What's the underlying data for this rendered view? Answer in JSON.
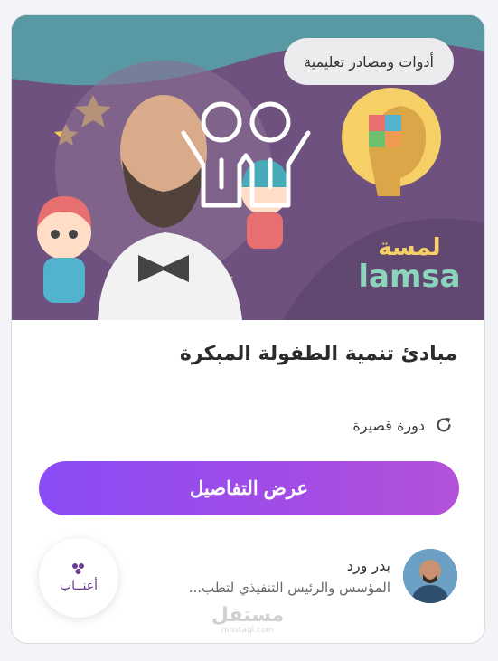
{
  "card": {
    "category_tag": "أدوات ومصادر تعليمية",
    "title": "مبادئ تنمية الطفولة المبكرة",
    "course_type": "دورة قصيرة",
    "cta_label": "عرض التفاصيل",
    "author": {
      "name": "بدر ورد",
      "role": "المؤسس والرئيس التنفيذي لتطب..."
    },
    "org_logo_text": "أعنــاب",
    "hero_logo_text": "lamsa",
    "hero_logo_arabic": "لمسة"
  },
  "watermark": {
    "main": "مستقل",
    "sub": "mostaql.com"
  },
  "colors": {
    "accent_start": "#8a4cf6",
    "accent_end": "#b352d9",
    "hero_bg": "#5b3a6e"
  }
}
